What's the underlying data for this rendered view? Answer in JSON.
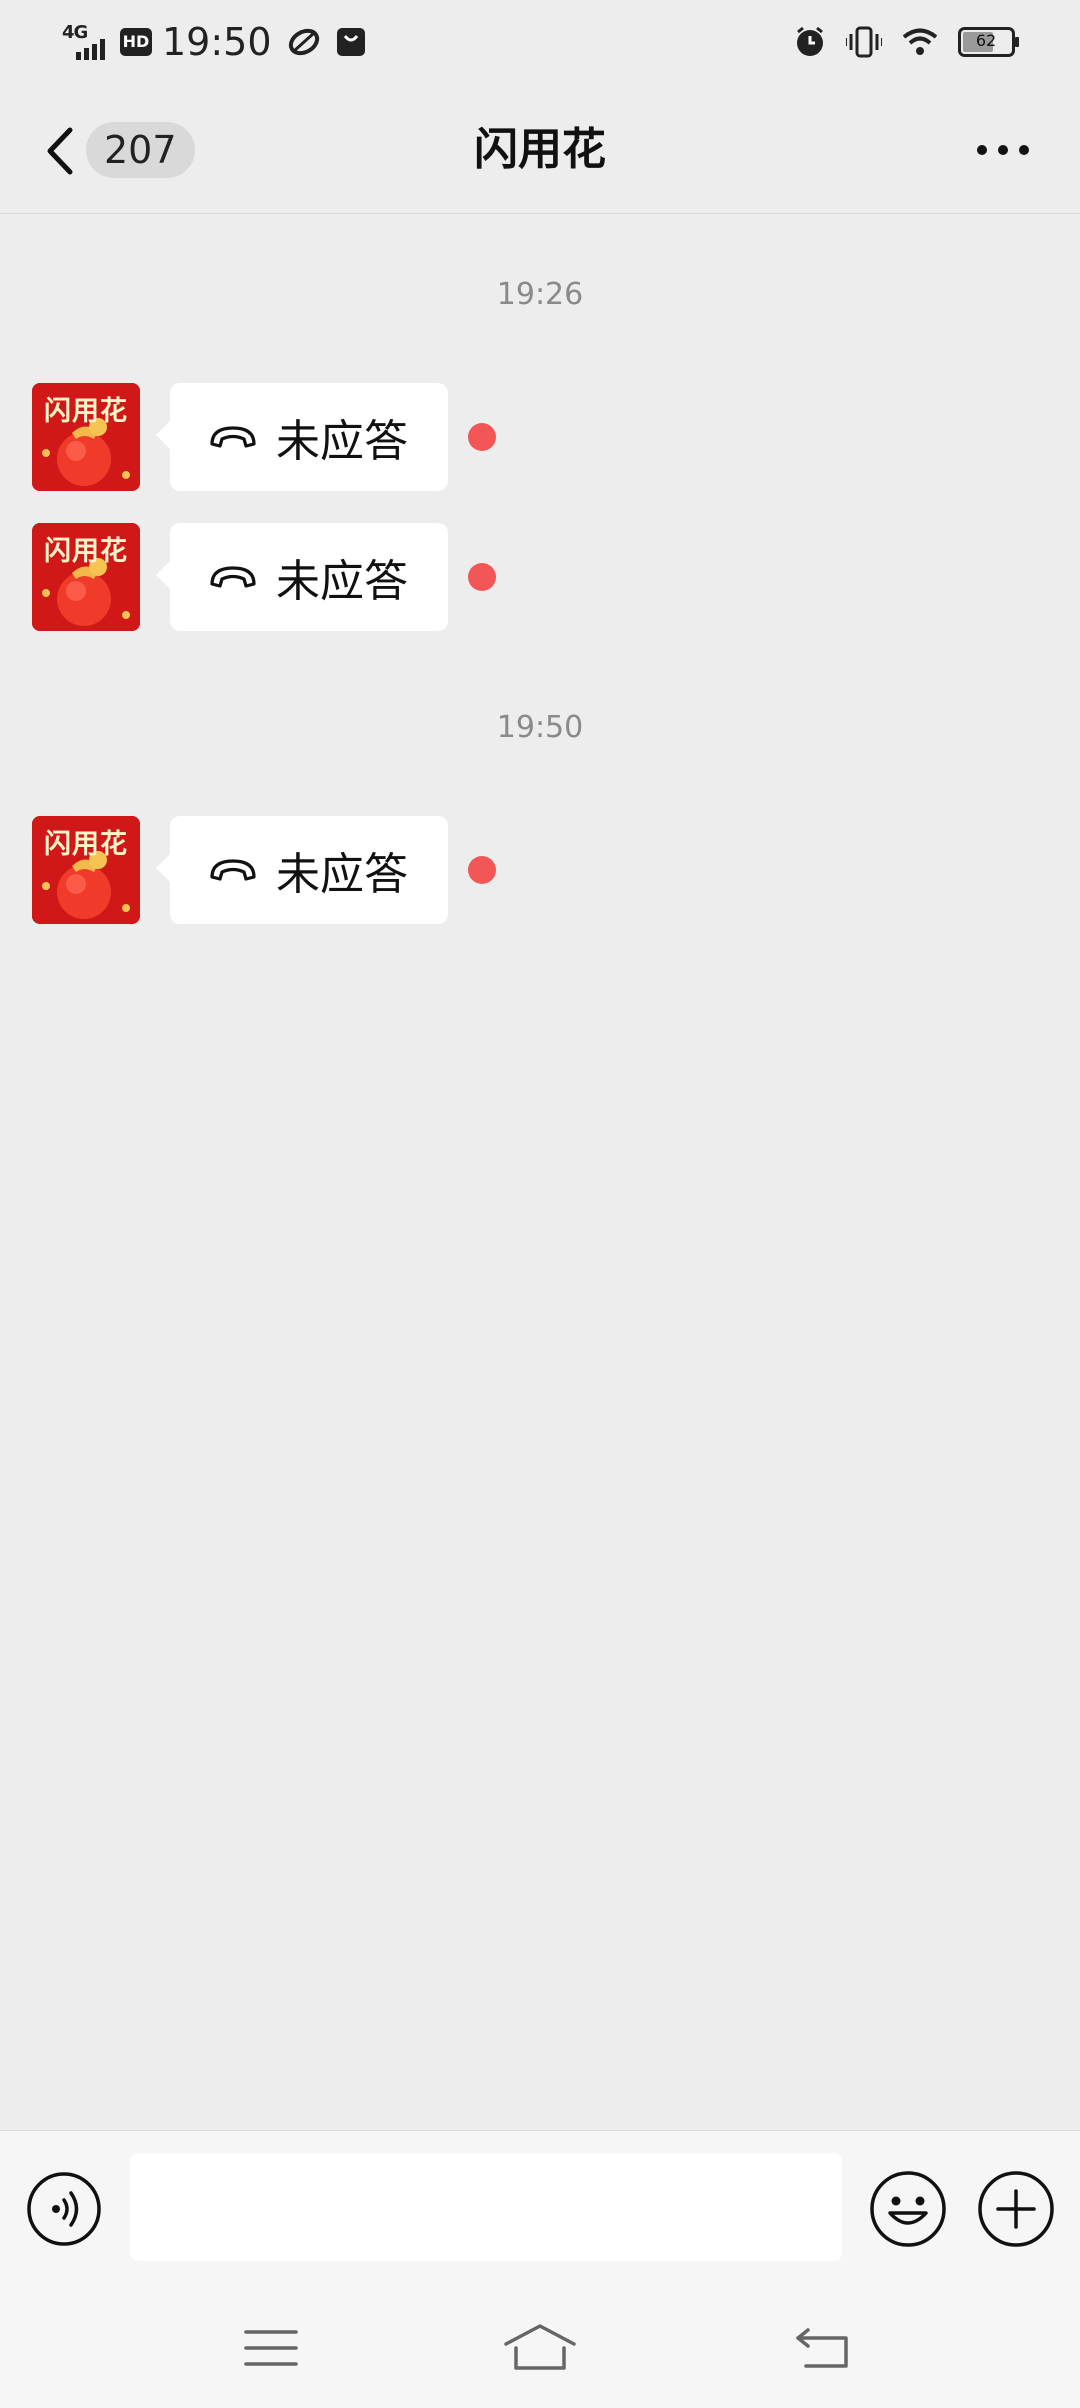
{
  "status_bar": {
    "network": "4G",
    "hd_label": "HD",
    "time": "19:50",
    "battery": "62"
  },
  "header": {
    "unread_count": "207",
    "title": "闪用花"
  },
  "contact": {
    "avatar_text": "闪用花"
  },
  "messages": [
    {
      "type": "timestamp",
      "text": "19:26"
    },
    {
      "type": "missed_call",
      "text": "未应答",
      "unread": true
    },
    {
      "type": "missed_call",
      "text": "未应答",
      "unread": true
    },
    {
      "type": "timestamp",
      "text": "19:50"
    },
    {
      "type": "missed_call",
      "text": "未应答",
      "unread": true
    }
  ],
  "input": {
    "value": "",
    "placeholder": ""
  },
  "colors": {
    "background": "#ededed",
    "bubble": "#ffffff",
    "unread_dot": "#f25656",
    "avatar": "#d21a1a"
  }
}
